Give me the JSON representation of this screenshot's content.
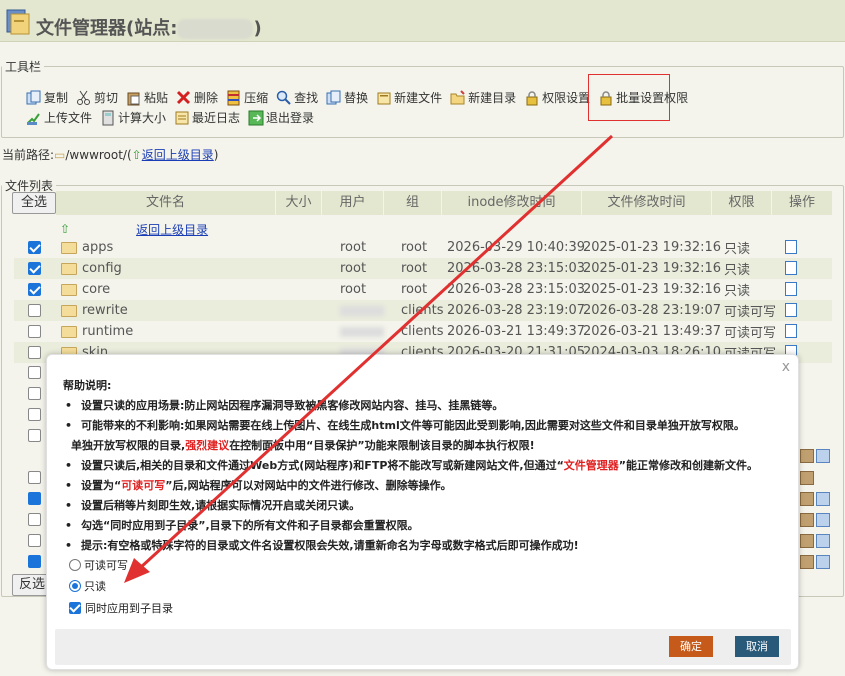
{
  "header": {
    "title": "文件管理器(站点:",
    "title_end": ")"
  },
  "toolbar": {
    "legend": "工具栏",
    "row1": [
      {
        "label": "复制",
        "icon": "copy-icon"
      },
      {
        "label": "剪切",
        "icon": "scissors-icon"
      },
      {
        "label": "粘贴",
        "icon": "paste-icon"
      },
      {
        "label": "删除",
        "icon": "delete-icon"
      },
      {
        "label": "压缩",
        "icon": "compress-icon"
      },
      {
        "label": "查找",
        "icon": "search-icon"
      },
      {
        "label": "替换",
        "icon": "replace-icon"
      },
      {
        "label": "新建文件",
        "icon": "new-file-icon"
      },
      {
        "label": "新建目录",
        "icon": "new-folder-icon"
      },
      {
        "label": "权限设置",
        "icon": "lock-icon"
      },
      {
        "label": "批量设置权限",
        "icon": "lock-icon"
      }
    ],
    "row2": [
      {
        "label": "上传文件",
        "icon": "upload-icon"
      },
      {
        "label": "计算大小",
        "icon": "calculator-icon"
      },
      {
        "label": "最近日志",
        "icon": "log-icon"
      },
      {
        "label": "退出登录",
        "icon": "logout-icon"
      }
    ]
  },
  "path": {
    "label": "当前路径:",
    "value": "/wwwroot/(",
    "back": "返回上级目录",
    "close": ")"
  },
  "filelist": {
    "legend": "文件列表",
    "select_all": "全选",
    "reverse": "反选",
    "back_link": "返回上级目录",
    "columns": [
      "文件名",
      "大小",
      "用户",
      "组",
      "inode修改时间",
      "文件修改时间",
      "权限",
      "操作"
    ],
    "rows": [
      {
        "name": "apps",
        "user": "root",
        "group": "root",
        "inode": "2026-03-29 10:40:39",
        "mtime": "2025-01-23 19:32:16",
        "perm": "只读",
        "checked": true
      },
      {
        "name": "config",
        "user": "root",
        "group": "root",
        "inode": "2026-03-28 23:15:03",
        "mtime": "2025-01-23 19:32:16",
        "perm": "只读",
        "checked": true
      },
      {
        "name": "core",
        "user": "root",
        "group": "root",
        "inode": "2026-03-28 23:15:03",
        "mtime": "2025-01-23 19:32:16",
        "perm": "只读",
        "checked": true
      },
      {
        "name": "rewrite",
        "user": "",
        "group": "clients",
        "inode": "2026-03-28 23:19:07",
        "mtime": "2026-03-28 23:19:07",
        "perm": "可读可写",
        "checked": false
      },
      {
        "name": "runtime",
        "user": "",
        "group": "clients",
        "inode": "2026-03-21 13:49:37",
        "mtime": "2026-03-21 13:49:37",
        "perm": "可读可写",
        "checked": false
      },
      {
        "name": "skin",
        "user": "",
        "group": "clients",
        "inode": "2026-03-20 21:31:05",
        "mtime": "2024-03-03 18:26:10",
        "perm": "可读可写",
        "checked": false
      }
    ]
  },
  "dialog": {
    "help_title": "帮助说明:",
    "items": [
      "设置只读的应用场景:防止网站因程序漏洞导致被黑客修改网站内容、挂马、挂黑链等。",
      "可能带来的不利影响:如果网站需要在线上传图片、在线生成html文件等可能因此受到影响,因此需要对这些文件和目录单独开放写权限。"
    ],
    "sub_a": "单独开放写权限的目录,",
    "sub_red": "强烈建议",
    "sub_b": "在控制面板中用“目录保护”功能来限制该目录的脚本执行权限!",
    "item3_a": "设置只读后,相关的目录和文件通过Web方式(网站程序)和FTP将不能改写或新建网站文件,但通过“",
    "item3_red": "文件管理器",
    "item3_b": "”能正常修改和创建新文件。",
    "item4_a": "设置为“",
    "item4_red": "可读可写",
    "item4_b": "”后,网站程序可以对网站中的文件进行修改、删除等操作。",
    "item5": "设置后稍等片刻即生效,请根据实际情况开启或关闭只读。",
    "item6": "勾选“同时应用到子目录”,目录下的所有文件和子目录都会重置权限。",
    "item7": "提示:有空格或特殊字符的目录或文件名设置权限会失效,请重新命名为字母或数字格式后即可操作成功!",
    "opt_rw": "可读可写",
    "opt_ro": "只读",
    "opt_sub": "同时应用到子目录",
    "ok": "确定",
    "cancel": "取消",
    "close": "x"
  }
}
